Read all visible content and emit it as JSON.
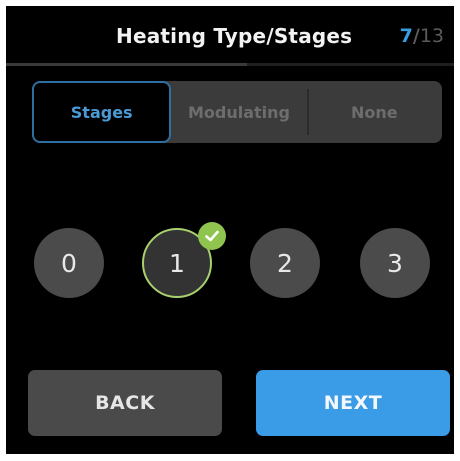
{
  "header": {
    "title": "Heating Type/Stages",
    "step_current": "7",
    "step_separator": "/",
    "step_total": "13",
    "progress": 0.5385
  },
  "tabs": [
    {
      "label": "Stages",
      "active": true
    },
    {
      "label": "Modulating",
      "active": false
    },
    {
      "label": "None",
      "active": false
    }
  ],
  "stages": {
    "options": [
      "0",
      "1",
      "2",
      "3"
    ],
    "selected": "1"
  },
  "buttons": {
    "back_label": "BACK",
    "next_label": "NEXT"
  },
  "colors": {
    "accent": "#3a9be6",
    "selected_ring": "#a8d16d",
    "check": "#8fc54f",
    "background": "#000000"
  },
  "icons": {
    "check": "check-icon"
  }
}
